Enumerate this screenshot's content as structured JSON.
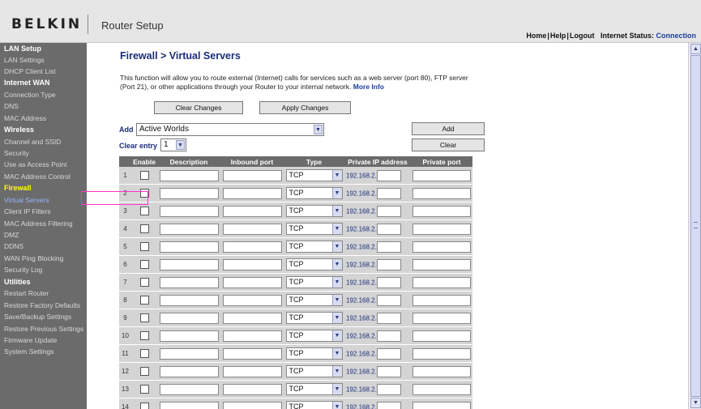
{
  "header": {
    "brand": "BELKIN",
    "title": "Router Setup",
    "links": [
      "Home",
      "Help",
      "Logout"
    ],
    "status_label": "Internet Status:",
    "status_value": "Connection"
  },
  "sidebar": {
    "sections": [
      {
        "title": "LAN Setup",
        "items": [
          "LAN Settings",
          "DHCP Client List"
        ]
      },
      {
        "title": "Internet WAN",
        "items": [
          "Connection Type",
          "DNS",
          "MAC Address"
        ]
      },
      {
        "title": "Wireless",
        "items": [
          "Channel and SSID",
          "Security",
          "Use as Access Point",
          "MAC Address Control"
        ]
      },
      {
        "title": "Firewall",
        "items": [
          "Virtual Servers",
          "Client IP Filters",
          "MAC Address Filtering",
          "DMZ",
          "DDNS",
          "WAN Ping Blocking",
          "Security Log"
        ]
      },
      {
        "title": "Utilities",
        "items": [
          "Restart Router",
          "Restore Factory Defaults",
          "Save/Backup Settings",
          "Restore Previous Settings",
          "Firmware Update",
          "System Settings"
        ]
      }
    ]
  },
  "main": {
    "title": "Firewall > Virtual Servers",
    "description": "This function will allow you to route external (Internet) calls for services such as a web server (port 80), FTP server (Port 21), or other applications through your Router to your internal network.",
    "more_info": "More Info",
    "clear_changes": "Clear Changes",
    "apply_changes": "Apply Changes",
    "add_label": "Add",
    "add_select_value": "Active Worlds",
    "add_button": "Add",
    "clear_entry_label": "Clear entry",
    "clear_entry_value": "1",
    "clear_button": "Clear",
    "table": {
      "columns": [
        "",
        "Enable",
        "Description",
        "Inbound port",
        "Type",
        "Private IP address",
        "Private port"
      ],
      "type_value": "TCP",
      "ip_prefix": "192.168.2.",
      "row_numbers": [
        "1",
        "2",
        "3",
        "4",
        "5",
        "6",
        "7",
        "8",
        "9",
        "10",
        "11",
        "12",
        "13",
        "14"
      ]
    }
  },
  "colors": {
    "sidebar_bg": "#6b6b6b",
    "header_bg": "#e6e6e6",
    "title_blue": "#1a2e7a",
    "active_yellow": "#ffff00",
    "annotation": "#ff33cc"
  }
}
